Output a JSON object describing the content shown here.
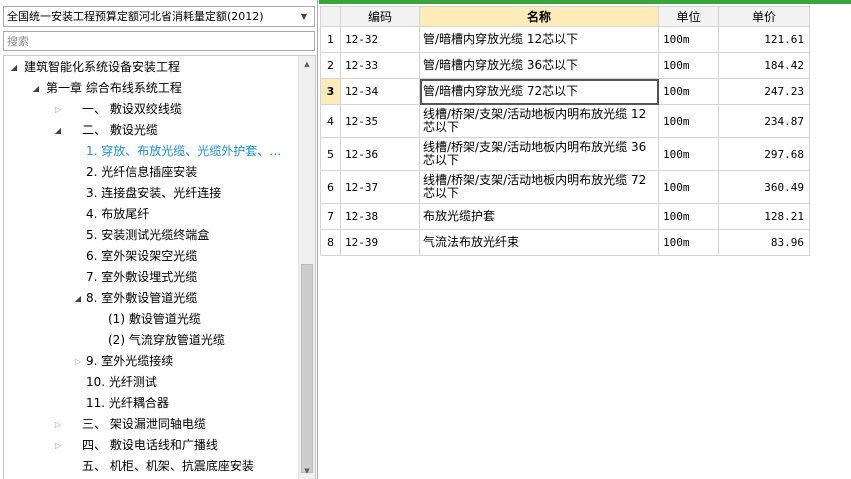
{
  "library": {
    "selected": "全国统一安装工程预算定额河北省消耗量定额(2012)"
  },
  "search": {
    "placeholder": "搜索"
  },
  "tree": [
    {
      "label": "建筑智能化系统设备安装工程",
      "level": 0,
      "toggle": "expanded"
    },
    {
      "label": "第一章  综合布线系统工程",
      "level": 1,
      "toggle": "expanded"
    },
    {
      "label": "一、  敷设双绞线缆",
      "level": 2,
      "toggle": "collapsed"
    },
    {
      "label": "二、  敷设光缆",
      "level": 2,
      "toggle": "expanded"
    },
    {
      "label": "1.  穿放、布放光缆、光缆外护套、…",
      "level": 3,
      "toggle": "none",
      "selected": true
    },
    {
      "label": "2.  光纤信息插座安装",
      "level": 3,
      "toggle": "none"
    },
    {
      "label": "3.  连接盘安装、光纤连接",
      "level": 3,
      "toggle": "none"
    },
    {
      "label": "4.  布放尾纤",
      "level": 3,
      "toggle": "none"
    },
    {
      "label": "5.  安装测试光缆终端盒",
      "level": 3,
      "toggle": "none"
    },
    {
      "label": "6.  室外架设架空光缆",
      "level": 3,
      "toggle": "none"
    },
    {
      "label": "7.  室外敷设埋式光缆",
      "level": 3,
      "toggle": "none"
    },
    {
      "label": "8.  室外敷设管道光缆",
      "level": 3,
      "toggle": "expanded"
    },
    {
      "label": "(1)  敷设管道光缆",
      "level": 4,
      "toggle": "none"
    },
    {
      "label": "(2)  气流穿放管道光缆",
      "level": 4,
      "toggle": "none"
    },
    {
      "label": "9.  室外光缆接续",
      "level": 3,
      "toggle": "collapsed"
    },
    {
      "label": "10.  光纤测试",
      "level": 3,
      "toggle": "none"
    },
    {
      "label": "11.  光纤耦合器",
      "level": 3,
      "toggle": "none"
    },
    {
      "label": "三、  架设漏泄同轴电缆",
      "level": 2,
      "toggle": "collapsed"
    },
    {
      "label": "四、  敷设电话线和广播线",
      "level": 2,
      "toggle": "collapsed"
    },
    {
      "label": "五、  机柜、机架、抗震底座安装",
      "level": 2,
      "toggle": "none"
    }
  ],
  "grid": {
    "headers": {
      "num": "",
      "code": "编码",
      "name": "名称",
      "unit": "单位",
      "price": "单价"
    },
    "rows": [
      {
        "num": "1",
        "code": "12-32",
        "name": "管/暗槽内穿放光缆 12芯以下",
        "unit": "100m",
        "price": "121.61"
      },
      {
        "num": "2",
        "code": "12-33",
        "name": "管/暗槽内穿放光缆 36芯以下",
        "unit": "100m",
        "price": "184.42"
      },
      {
        "num": "3",
        "code": "12-34",
        "name": "管/暗槽内穿放光缆 72芯以下",
        "unit": "100m",
        "price": "247.23",
        "current": true
      },
      {
        "num": "4",
        "code": "12-35",
        "name": "线槽/桥架/支架/活动地板内明布放光缆 12芯以下",
        "unit": "100m",
        "price": "234.87",
        "tall": true
      },
      {
        "num": "5",
        "code": "12-36",
        "name": "线槽/桥架/支架/活动地板内明布放光缆 36芯以下",
        "unit": "100m",
        "price": "297.68",
        "tall": true
      },
      {
        "num": "6",
        "code": "12-37",
        "name": "线槽/桥架/支架/活动地板内明布放光缆 72芯以下",
        "unit": "100m",
        "price": "360.49",
        "tall": true
      },
      {
        "num": "7",
        "code": "12-38",
        "name": "布放光缆护套",
        "unit": "100m",
        "price": "128.21"
      },
      {
        "num": "8",
        "code": "12-39",
        "name": "气流法布放光纤束",
        "unit": "100m",
        "price": "83.96"
      }
    ]
  },
  "icons": {
    "dropdown": "chevron-down-icon",
    "expanded": "expanded-triangle-icon",
    "collapsed": "collapsed-triangle-icon"
  },
  "colors": {
    "selected_node": "#1e8fd6",
    "header_highlight": "#fdecb8",
    "top_accent": "#3aa33a"
  }
}
